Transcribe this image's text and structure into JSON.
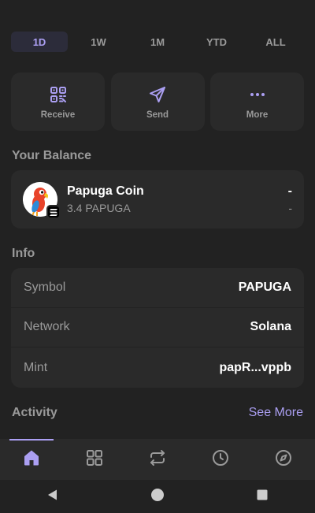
{
  "range_tabs": [
    {
      "label": "1D",
      "active": true
    },
    {
      "label": "1W",
      "active": false
    },
    {
      "label": "1M",
      "active": false
    },
    {
      "label": "YTD",
      "active": false
    },
    {
      "label": "ALL",
      "active": false
    }
  ],
  "actions": [
    {
      "label": "Receive",
      "icon": "qr-code-icon"
    },
    {
      "label": "Send",
      "icon": "paper-plane-icon"
    },
    {
      "label": "More",
      "icon": "more-dots-icon"
    }
  ],
  "balance": {
    "title": "Your Balance",
    "token_name": "Papuga Coin",
    "token_amount": "3.4 PAPUGA",
    "value": "-",
    "change": "-"
  },
  "info": {
    "title": "Info",
    "rows": [
      {
        "key": "Symbol",
        "value": "PAPUGA"
      },
      {
        "key": "Network",
        "value": "Solana"
      },
      {
        "key": "Mint",
        "value": "papR...vppb"
      }
    ]
  },
  "activity": {
    "title": "Activity",
    "see_more": "See More"
  },
  "bottom_nav": [
    "home-icon",
    "grid-icon",
    "swap-arrows-icon",
    "clock-icon",
    "compass-icon"
  ],
  "system_nav": [
    "back-icon",
    "home-circle-icon",
    "recents-icon"
  ],
  "colors": {
    "background": "#222222",
    "card": "#2a2a2a",
    "accent": "#ab9ff2",
    "muted": "#9a9a9a"
  }
}
